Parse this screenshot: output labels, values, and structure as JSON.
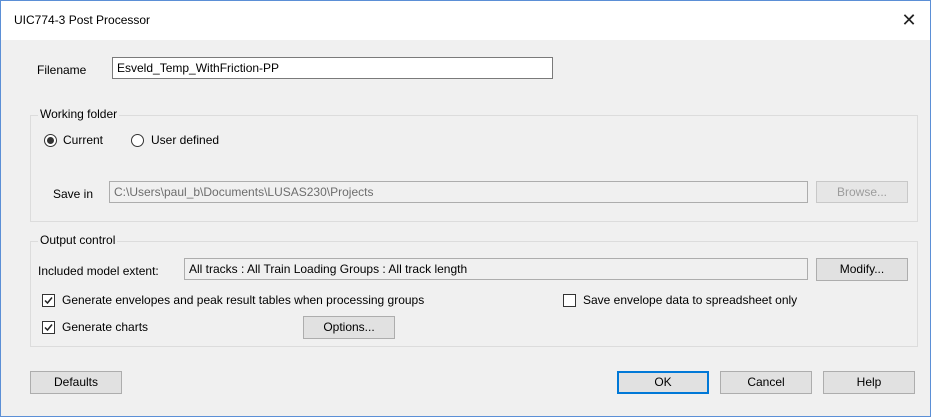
{
  "window": {
    "title": "UIC774-3 Post Processor",
    "close_glyph": "✕"
  },
  "filename": {
    "label": "Filename",
    "value": "Esveld_Temp_WithFriction-PP"
  },
  "working_folder": {
    "legend": "Working folder",
    "radio_current": "Current",
    "radio_user": "User defined",
    "selected": "Current",
    "save_in_label": "Save in",
    "save_in_value": "C:\\Users\\paul_b\\Documents\\LUSAS230\\Projects",
    "browse_label": "Browse..."
  },
  "output_control": {
    "legend": "Output control",
    "extent_label": "Included model extent:",
    "extent_value": "All tracks : All Train Loading Groups : All track length",
    "modify_label": "Modify...",
    "generate_envelopes_label": "Generate envelopes and peak result tables when processing groups",
    "generate_envelopes_checked": true,
    "save_envelope_label": "Save envelope data to spreadsheet only",
    "save_envelope_checked": false,
    "generate_charts_label": "Generate charts",
    "generate_charts_checked": true,
    "options_label": "Options..."
  },
  "buttons": {
    "defaults": "Defaults",
    "ok": "OK",
    "cancel": "Cancel",
    "help": "Help"
  }
}
